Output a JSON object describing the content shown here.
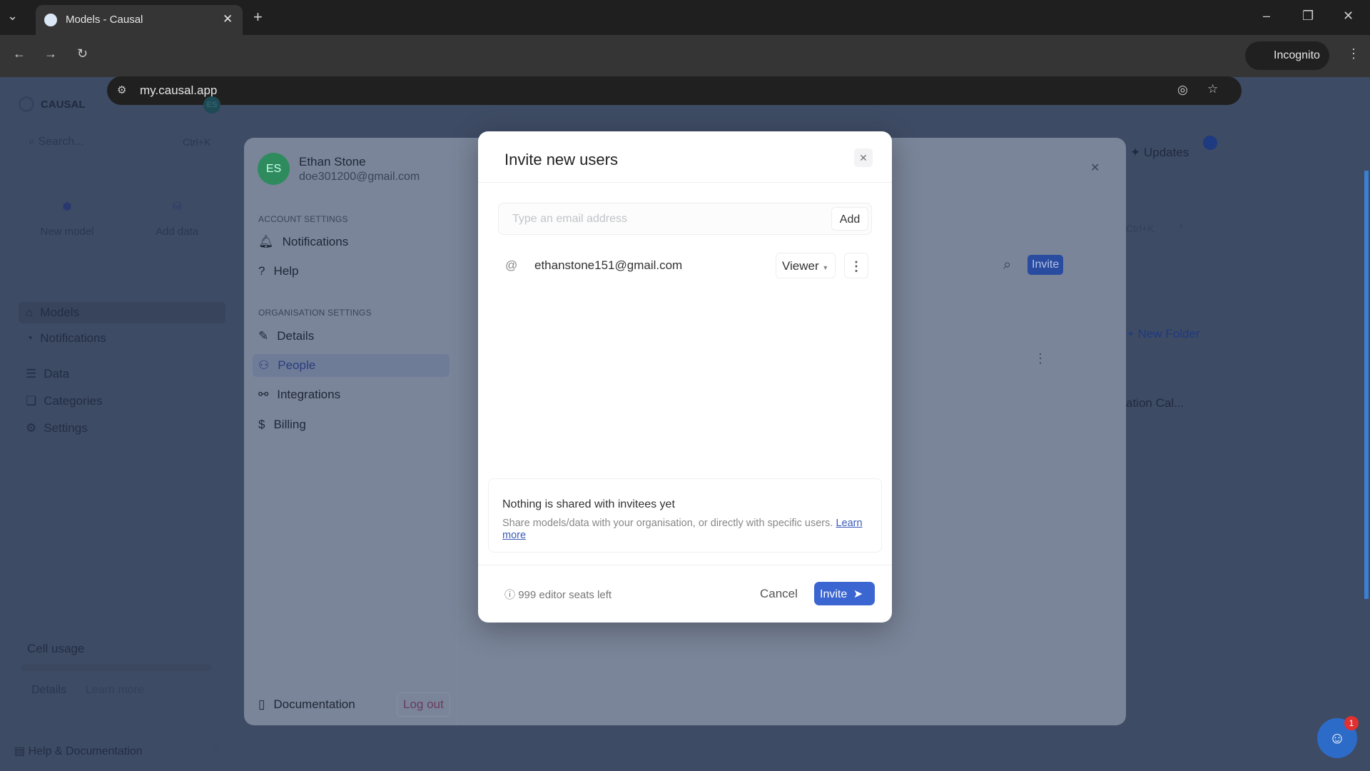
{
  "browser": {
    "tab_title": "Models - Causal",
    "url": "my.causal.app",
    "incognito_label": "Incognito"
  },
  "sidebar": {
    "logo": "CAUSAL",
    "avatar": "ES",
    "search_placeholder": "Search...",
    "search_shortcut": "Ctrl+K",
    "cards": [
      {
        "label": "New model"
      },
      {
        "label": "Add data"
      }
    ],
    "items": [
      {
        "label": "Models"
      },
      {
        "label": "Notifications"
      },
      {
        "label": "Data"
      },
      {
        "label": "Categories"
      },
      {
        "label": "Settings"
      }
    ],
    "cell_usage": "Cell usage",
    "details": "Details",
    "learn_more": "Learn more",
    "help": "Help & Documentation"
  },
  "background": {
    "updates": "Updates",
    "shortcut": "Ctrl+K",
    "new_folder": "New Folder",
    "model_name": "ation Cal..."
  },
  "settings": {
    "user_name": "Ethan Stone",
    "user_email": "doe301200@gmail.com",
    "avatar": "ES",
    "account_heading": "ACCOUNT SETTINGS",
    "account_items": [
      {
        "label": "Notifications"
      },
      {
        "label": "Help"
      }
    ],
    "org_heading": "ORGANISATION SETTINGS",
    "org_items": [
      {
        "label": "Details"
      },
      {
        "label": "People"
      },
      {
        "label": "Integrations"
      },
      {
        "label": "Billing"
      }
    ],
    "selected": "People",
    "documentation": "Documentation",
    "logout": "Log out",
    "invite": "Invite"
  },
  "modal": {
    "title": "Invite new users",
    "email_placeholder": "Type an email address",
    "add_label": "Add",
    "invitees": [
      {
        "email": "ethanstone151@gmail.com",
        "role": "Viewer"
      }
    ],
    "info_title": "Nothing is shared with invitees yet",
    "info_text": "Share models/data with your organisation, or directly with specific users.",
    "info_link": "Learn more",
    "seats": "999 editor seats left",
    "cancel": "Cancel",
    "invite": "Invite"
  },
  "chat": {
    "badge": "1"
  },
  "colors": {
    "accent": "#3b66d1",
    "avatar": "#2e8b5e"
  }
}
